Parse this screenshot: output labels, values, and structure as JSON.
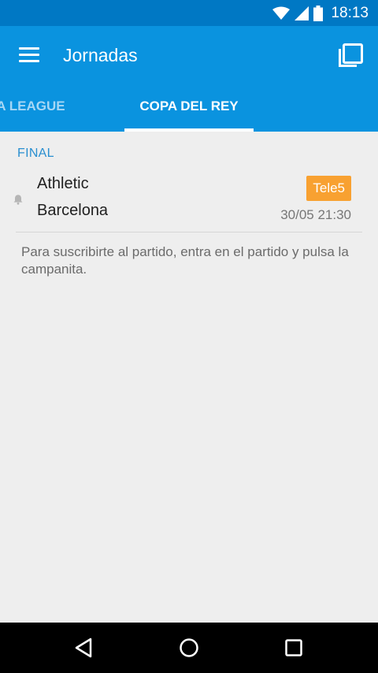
{
  "status_bar": {
    "time": "18:13",
    "icons": [
      "wifi-icon",
      "signal-icon",
      "battery-icon"
    ]
  },
  "app_bar": {
    "title": "Jornadas",
    "menu_icon": "menu-icon",
    "action_icon": "copy-icon"
  },
  "tabs": [
    {
      "label": "PA LEAGUE",
      "active": false
    },
    {
      "label": "COPA DEL REY",
      "active": true
    }
  ],
  "section": {
    "title": "FINAL"
  },
  "match": {
    "home_team": "Athletic",
    "away_team": "Barcelona",
    "channel": "Tele5",
    "datetime": "30/05 21:30",
    "bell_icon": "bell-icon"
  },
  "hint": "Para suscribirte al partido, entra en el partido y pulsa la campanita.",
  "colors": {
    "status_bar": "#0078c4",
    "app_bar": "#0a93df",
    "accent": "#2a8fd0",
    "badge": "#f8a131",
    "background": "#eeeeee"
  },
  "nav_bar": [
    "back-icon",
    "home-icon",
    "recents-icon"
  ]
}
